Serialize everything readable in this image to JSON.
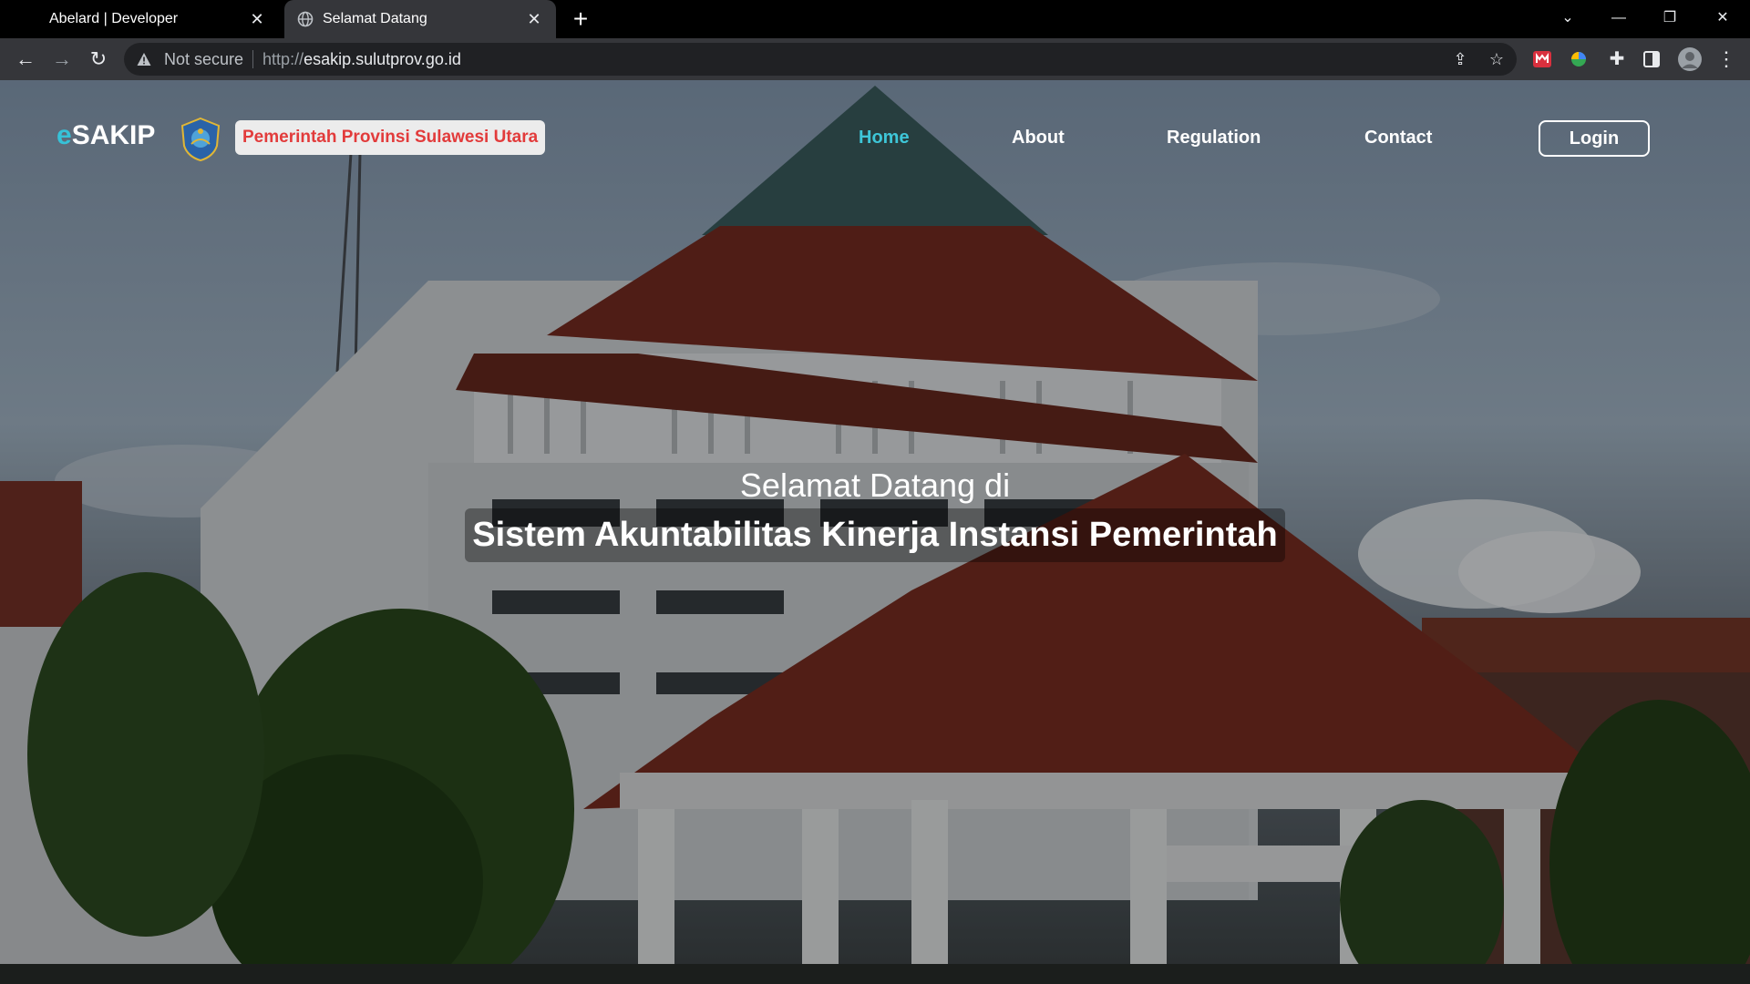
{
  "browser": {
    "tabs": [
      {
        "title": "Abelard | Developer",
        "active": false
      },
      {
        "title": "Selamat Datang",
        "active": true
      }
    ],
    "new_tab": "+",
    "security_label": "Not secure",
    "url_scheme": "http://",
    "url_host": "esakip.sulutprov.go.id"
  },
  "site": {
    "brand_prefix": "e",
    "brand_main": "SAKIP",
    "province": "Pemerintah Provinsi Sulawesi Utara",
    "nav": [
      "Home",
      "About",
      "Regulation",
      "Contact"
    ],
    "active_nav": "Home",
    "login": "Login"
  },
  "hero": {
    "subtitle": "Selamat Datang di",
    "title": "Sistem Akuntabilitas Kinerja Instansi Pemerintah"
  },
  "colors": {
    "accent": "#3ec6d8",
    "badge_text": "#e23b3b",
    "chrome_toolbar": "#35363a"
  }
}
